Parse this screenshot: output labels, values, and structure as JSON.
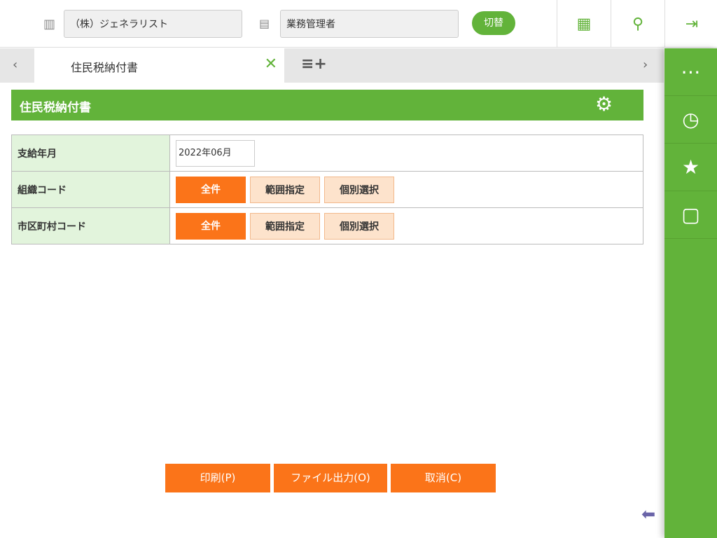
{
  "header": {
    "company": "（株）ジェネラリスト",
    "role": "業務管理者",
    "switch_label": "切替"
  },
  "tabs": {
    "active": "住民税納付書"
  },
  "panel": {
    "title": "住民税納付書"
  },
  "form": {
    "rows": [
      {
        "label": "支給年月",
        "value": "2022年06月"
      },
      {
        "label": "組織コード",
        "buttons": [
          "全件",
          "範囲指定",
          "個別選択"
        ]
      },
      {
        "label": "市区町村コード",
        "buttons": [
          "全件",
          "範囲指定",
          "個別選択"
        ]
      }
    ]
  },
  "footer": {
    "print": "印刷(P)",
    "file": "ファイル出力(O)",
    "cancel": "取消(C)"
  }
}
